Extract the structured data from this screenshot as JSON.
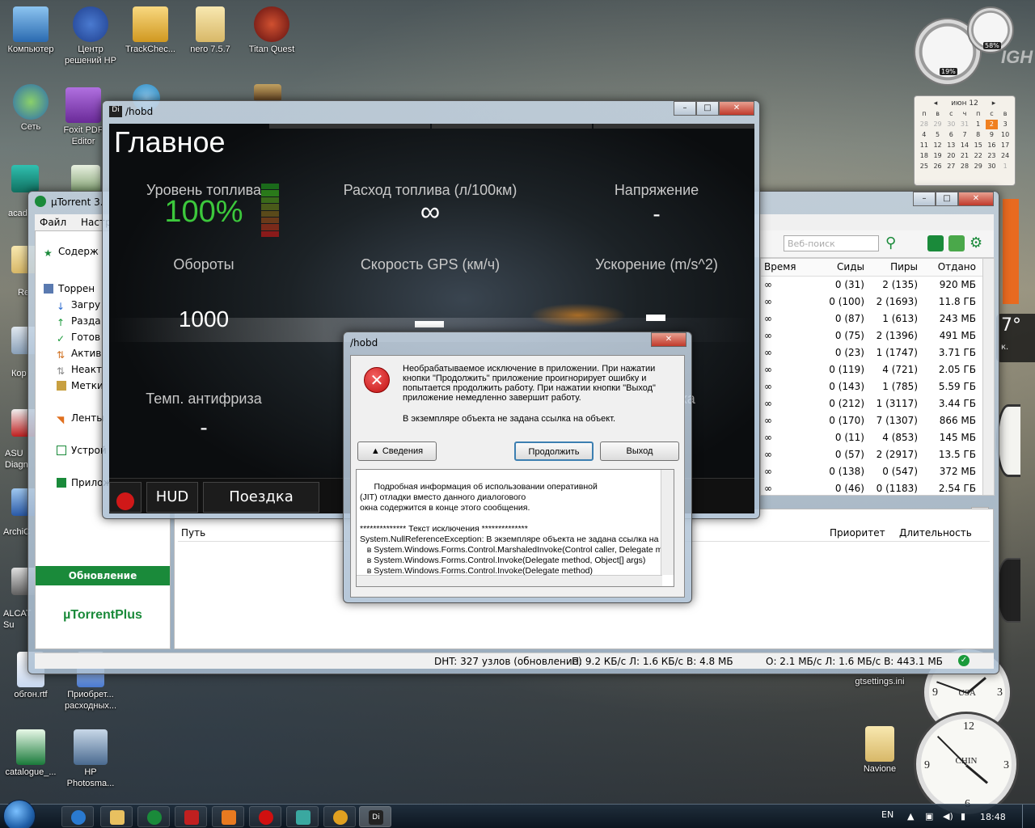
{
  "desktop": {
    "icons_left": [
      {
        "label": "Компьютер",
        "color": "#4a90d0"
      },
      {
        "label": "Центр решений HP",
        "color": "#1f4f9e"
      },
      {
        "label": "TrackChec...",
        "color": "#e8b030"
      },
      {
        "label": "nero 7.5.7",
        "color": "#e8c878"
      },
      {
        "label": "Titan Quest",
        "color": "#b02020"
      },
      {
        "label": "Сеть",
        "color": "#3a8ad0"
      },
      {
        "label": "Foxit PDF Editor",
        "color": "#7a3aa8"
      },
      {
        "label": "обгон.rtf",
        "color": "#2a5aa8"
      },
      {
        "label": "Приобрет... расходных...",
        "color": "#4a7ad0"
      },
      {
        "label": "catalogue_...",
        "color": "#1a7a3a"
      },
      {
        "label": "HP Photosma...",
        "color": "#2a5aa8"
      }
    ],
    "partial_labels": [
      "acad",
      "Re",
      "Кор",
      "ASU Diagn",
      "ArchiC",
      "ALCAT Su"
    ],
    "icons_right": [
      {
        "label": "gtsettings.ini"
      },
      {
        "label": "Navione"
      }
    ],
    "gadgets": {
      "cpu_percent": "19%",
      "mem_percent": "58%",
      "calendar": {
        "month": "июн 12",
        "weekdays": [
          "п",
          "в",
          "с",
          "ч",
          "п",
          "с",
          "в"
        ],
        "days": [
          "28",
          "29",
          "30",
          "31",
          "1",
          "2",
          "3",
          "4",
          "5",
          "6",
          "7",
          "8",
          "9",
          "10",
          "11",
          "12",
          "13",
          "14",
          "15",
          "16",
          "17",
          "18",
          "19",
          "20",
          "21",
          "22",
          "23",
          "24",
          "25",
          "26",
          "27",
          "28",
          "29",
          "30",
          "1"
        ],
        "today": "2"
      },
      "clocks": [
        {
          "city": "USA"
        },
        {
          "city": "CHIN"
        }
      ],
      "side_text": [
        "7°",
        "к."
      ],
      "hero_text": "IGH"
    }
  },
  "utorrent": {
    "title": "µTorrent 3.",
    "menu": [
      "Файл",
      "Настр"
    ],
    "sidebar": [
      "Содерж",
      "Торрен",
      "Загру",
      "Разда",
      "Готов",
      "Актив",
      "Неакт",
      "Метки",
      "Ленты",
      "Устрой",
      "Прилож"
    ],
    "update_label": "Обновление",
    "plus_label": "µTorrentPlus",
    "search_placeholder": "Веб-поиск",
    "columns": [
      "Время",
      "Сиды",
      "Пиры",
      "Отдано"
    ],
    "rows": [
      [
        "∞",
        "0 (31)",
        "2 (135)",
        "920 МБ"
      ],
      [
        "∞",
        "0 (100)",
        "2 (1693)",
        "11.8 ГБ"
      ],
      [
        "∞",
        "0 (87)",
        "1 (613)",
        "243 МБ"
      ],
      [
        "∞",
        "0 (75)",
        "2 (1396)",
        "491 МБ"
      ],
      [
        "∞",
        "0 (23)",
        "1 (1747)",
        "3.71 ГБ"
      ],
      [
        "∞",
        "0 (119)",
        "4 (721)",
        "2.05 ГБ"
      ],
      [
        "∞",
        "0 (143)",
        "1 (785)",
        "5.59 ГБ"
      ],
      [
        "∞",
        "0 (212)",
        "1 (3117)",
        "3.44 ГБ"
      ],
      [
        "∞",
        "0 (170)",
        "7 (1307)",
        "866 МБ"
      ],
      [
        "∞",
        "0 (11)",
        "4 (853)",
        "145 МБ"
      ],
      [
        "∞",
        "0 (57)",
        "2 (2917)",
        "13.5 ГБ"
      ],
      [
        "∞",
        "0 (138)",
        "0 (547)",
        "372 МБ"
      ],
      [
        "∞",
        "0 (46)",
        "0 (1183)",
        "2.54 ГБ"
      ]
    ],
    "bottom_columns": {
      "path": "Путь",
      "priority": "Приоритет",
      "duration": "Длительность"
    },
    "status": {
      "dht": "DHT: 327 узлов  (обновление)",
      "down": "П: 9.2 КБ/с Л: 1.6 КБ/с В: 4.8 МБ",
      "up": "О: 2.1 МБ/с Л: 1.6 МБ/с В: 443.1 МБ"
    }
  },
  "hobd": {
    "title": "/hobd",
    "page_title": "Главное",
    "fuel_level": {
      "label": "Уровень топлива",
      "value": "100%"
    },
    "fuel_rate": {
      "label": "Расход топлива (л/100км)",
      "value": "∞"
    },
    "voltage": {
      "label": "Напряжение",
      "value": "-"
    },
    "rpm": {
      "label": "Обороты",
      "value": "1000"
    },
    "gps_speed": {
      "label": "Скорость GPS (км/ч)"
    },
    "accel": {
      "label": "Ускорение (m/s^2)"
    },
    "coolant": {
      "label": "Темп. антифриза",
      "value": "-"
    },
    "partial_label": "ха",
    "buttons": {
      "hud": "HUD",
      "trip": "Поездка"
    }
  },
  "dialog": {
    "title": "/hobd",
    "message": "Необрабатываемое исключение в приложении. При нажатии кнопки \"Продолжить\" приложение проигнорирует ошибку и попытается продолжить работу. При нажатии кнопки \"Выход\" приложение немедленно завершит работу.",
    "message2": "В экземпляре объекта не задана ссылка на объект.",
    "details_label": "Сведения",
    "continue_label": "Продолжить",
    "exit_label": "Выход",
    "details_text": "Подробная информация об использовании оперативной\n(JIT) отладки вместо данного диалогового\nокна содержится в конце этого сообщения.\n\n************** Текст исключения **************\nSystem.NullReferenceException: В экземпляре объекта не задана ссылка на\n   в System.Windows.Forms.Control.MarshaledInvoke(Control caller, Delegate me\n   в System.Windows.Forms.Control.Invoke(Delegate method, Object[] args)\n   в System.Windows.Forms.Control.Invoke(Delegate method)\n   в Fleux.Controls.FleuxControl.Tap(Point p)"
  },
  "taskbar": {
    "lang": "EN",
    "time": "18:48"
  }
}
